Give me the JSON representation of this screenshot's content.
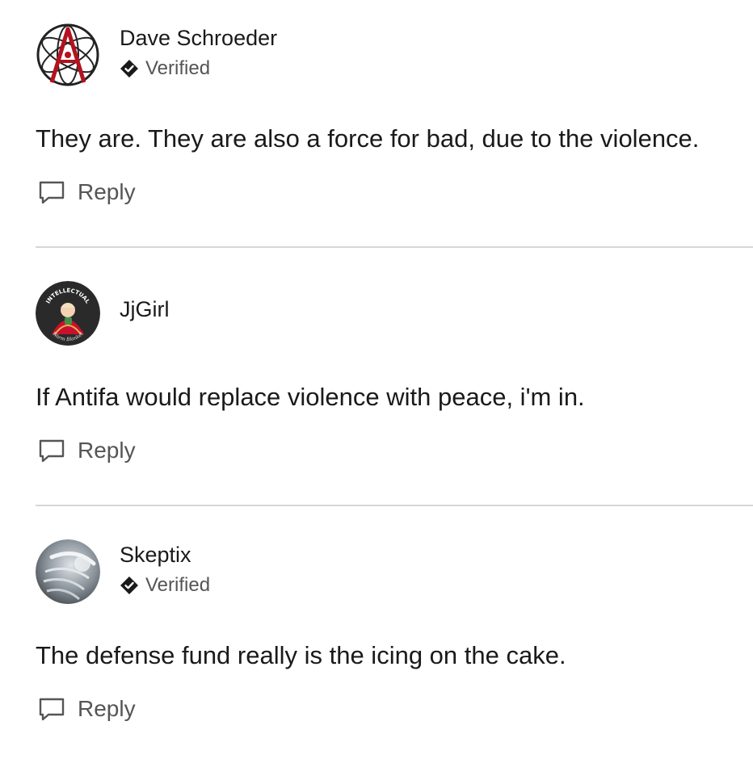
{
  "comments": [
    {
      "author": "Dave Schroeder",
      "verified": "Verified",
      "body": "They are. They are also a force for bad, due to the violence.",
      "reply_label": "Reply"
    },
    {
      "author": "JjGirl",
      "body": "If Antifa would replace violence with peace, i'm in.",
      "reply_label": "Reply",
      "avatar_text_top": "INTELLECTUAL",
      "avatar_text_bottom": "Warm Blanket"
    },
    {
      "author": "Skeptix",
      "verified": "Verified",
      "body": "The defense fund really is the icing on the cake.",
      "reply_label": "Reply"
    }
  ],
  "icons": {
    "verified": "diamond-check-icon",
    "reply": "speech-bubble-icon"
  },
  "colors": {
    "divider": "#d6d6d6",
    "text": "#1a1a1a",
    "muted": "#555555",
    "atheist_red": "#b3121e"
  }
}
